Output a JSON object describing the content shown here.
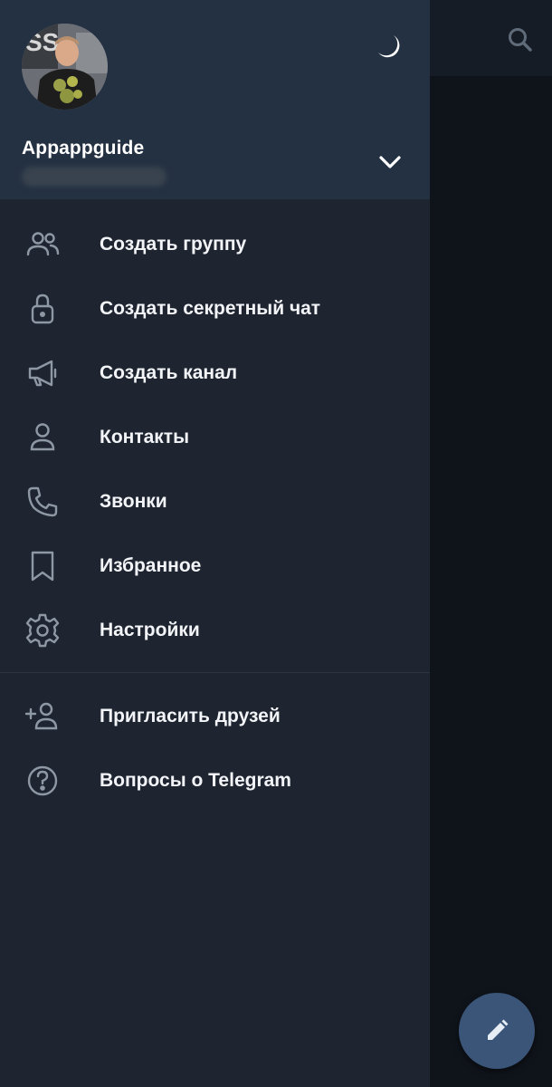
{
  "drawer": {
    "account": {
      "name": "Appappguide"
    },
    "menu": [
      {
        "label": "Создать группу",
        "icon": "group-icon"
      },
      {
        "label": "Создать секретный чат",
        "icon": "lock-icon"
      },
      {
        "label": "Создать канал",
        "icon": "megaphone-icon"
      },
      {
        "label": "Контакты",
        "icon": "person-icon"
      },
      {
        "label": "Звонки",
        "icon": "phone-icon"
      },
      {
        "label": "Избранное",
        "icon": "bookmark-icon"
      },
      {
        "label": "Настройки",
        "icon": "gear-icon"
      }
    ],
    "secondary_menu": [
      {
        "label": "Пригласить друзей",
        "icon": "add-person-icon"
      },
      {
        "label": "Вопросы о Telegram",
        "icon": "help-icon"
      }
    ]
  },
  "colors": {
    "drawer_bg": "#1e2530",
    "header_bg": "#243142",
    "fab_bg": "#3a5577",
    "icon_color": "#8e98a5",
    "text_color": "#f2f4f7"
  }
}
